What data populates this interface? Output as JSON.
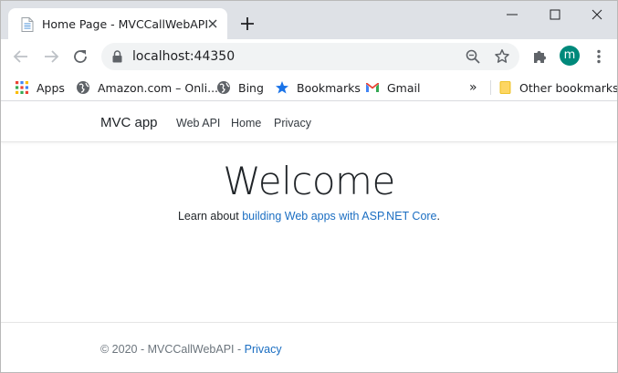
{
  "browser": {
    "tab_title": "Home Page - MVCCallWebAPI",
    "url": "localhost:44350",
    "avatar_letter": "m",
    "avatar_color": "#00897b",
    "bookmarks": [
      {
        "label": "Apps",
        "icon": "apps-grid-icon"
      },
      {
        "label": "Amazon.com – Onli...",
        "icon": "globe-icon"
      },
      {
        "label": "Bing",
        "icon": "globe-icon"
      },
      {
        "label": "Bookmarks",
        "icon": "star-icon"
      },
      {
        "label": "Gmail",
        "icon": "gmail-icon"
      }
    ],
    "overflow": "»",
    "other_bookmarks": "Other bookmarks"
  },
  "site": {
    "brand": "MVC app",
    "nav": [
      "Web API",
      "Home",
      "Privacy"
    ],
    "heading": "Welcome",
    "learn_prefix": "Learn about ",
    "learn_link": "building Web apps with ASP.NET Core",
    "learn_suffix": ".",
    "footer_text": "© 2020 - MVCCallWebAPI - ",
    "footer_link": "Privacy",
    "link_color": "#1b6ec2"
  }
}
